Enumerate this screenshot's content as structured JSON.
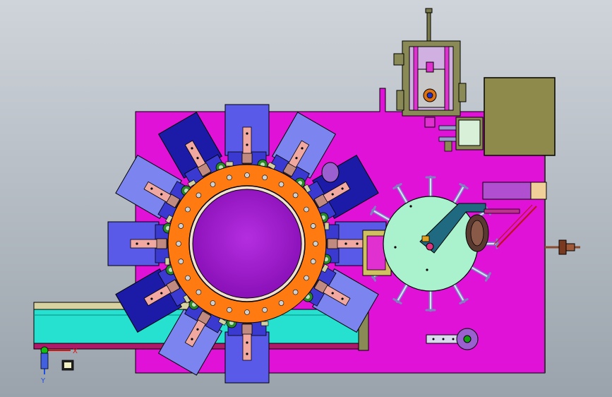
{
  "viewport": {
    "background_top": "#cfd4da",
    "background_bottom": "#9aa3ac"
  },
  "palette": {
    "base_plate": "#e012d8",
    "turret_hub": "#a218cc",
    "turret_ring": "#ff7a10",
    "station_block": "#5a5ae8",
    "station_block_light": "#7c84f0",
    "station_block_dark": "#1b1ba8",
    "slider": "#f0a8a0",
    "rotary_table": "#aaf2ce",
    "conveyor": "#26e0d0",
    "cabinet": "#8d8a4c",
    "frame": "#8a8a56",
    "outline": "#000000"
  },
  "turret": {
    "station_count": 12,
    "omitted_station_angles_deg": [
      60
    ]
  },
  "rotary_indexer": {
    "spoke_count": 12
  },
  "axis_triad": {
    "x_label": "X",
    "y_label": "Y",
    "x_color": "#e01010",
    "y_color": "#2050e0",
    "origin_color": "#10c010"
  }
}
